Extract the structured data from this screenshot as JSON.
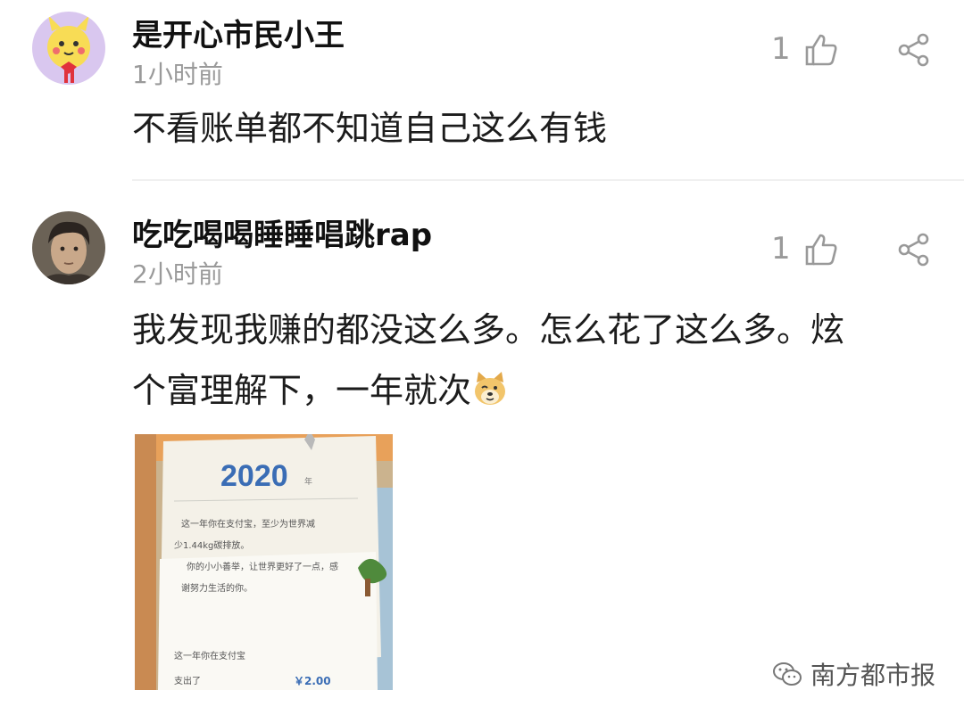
{
  "comments": [
    {
      "username": "是开心市民小王",
      "time": "1小时前",
      "likes": "1",
      "content": "不看账单都不知道自己这么有钱"
    },
    {
      "username": "吃吃喝喝睡睡唱跳rap",
      "time": "2小时前",
      "likes": "1",
      "content_line1": "我发现我赚的都没这么多。怎么花了这么多。炫",
      "content_line2": "个富理解下，一年就次",
      "image": {
        "year": "2020",
        "year_suffix": "年",
        "line1": "这一年你在支付宝，至少为世界减",
        "line2": "少1.44kg碳排放。",
        "line3": "你的小小善举，让世界更好了一点，感",
        "line4": "谢努力生活的你。",
        "line5": "这一年你在支付宝",
        "line6": "支出了",
        "amount": "￥2.00"
      }
    }
  ],
  "watermark": {
    "text": "南方都市报",
    "icon": "wechat-icon"
  },
  "colors": {
    "accent": "#3a6db5",
    "muted": "#9a9a9a"
  }
}
